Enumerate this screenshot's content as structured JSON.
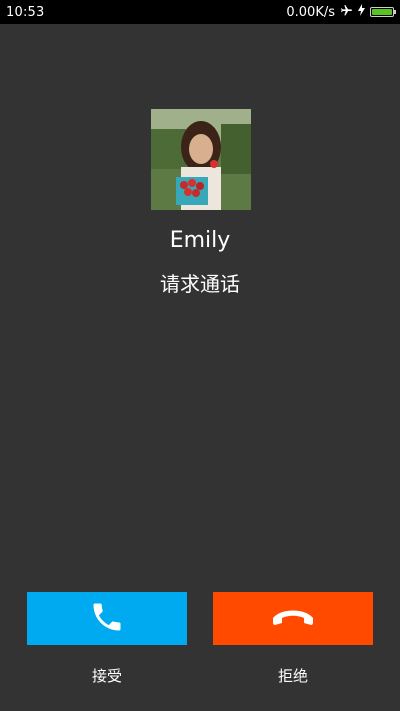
{
  "status_bar": {
    "time": "10:53",
    "network_speed": "0.00K/s",
    "icons": [
      "airplane-mode-icon",
      "charging-bolt-icon",
      "battery-icon"
    ],
    "battery_level": 1.0
  },
  "caller": {
    "name": "Emily",
    "status": "请求通话"
  },
  "actions": {
    "accept": {
      "label": "接受",
      "icon": "phone-handset-icon",
      "color": "#00aaf0"
    },
    "decline": {
      "label": "拒绝",
      "icon": "hang-up-icon",
      "color": "#ff4a00"
    }
  },
  "colors": {
    "background": "#333333",
    "status_bar": "#000000",
    "battery": "#58c41f"
  }
}
